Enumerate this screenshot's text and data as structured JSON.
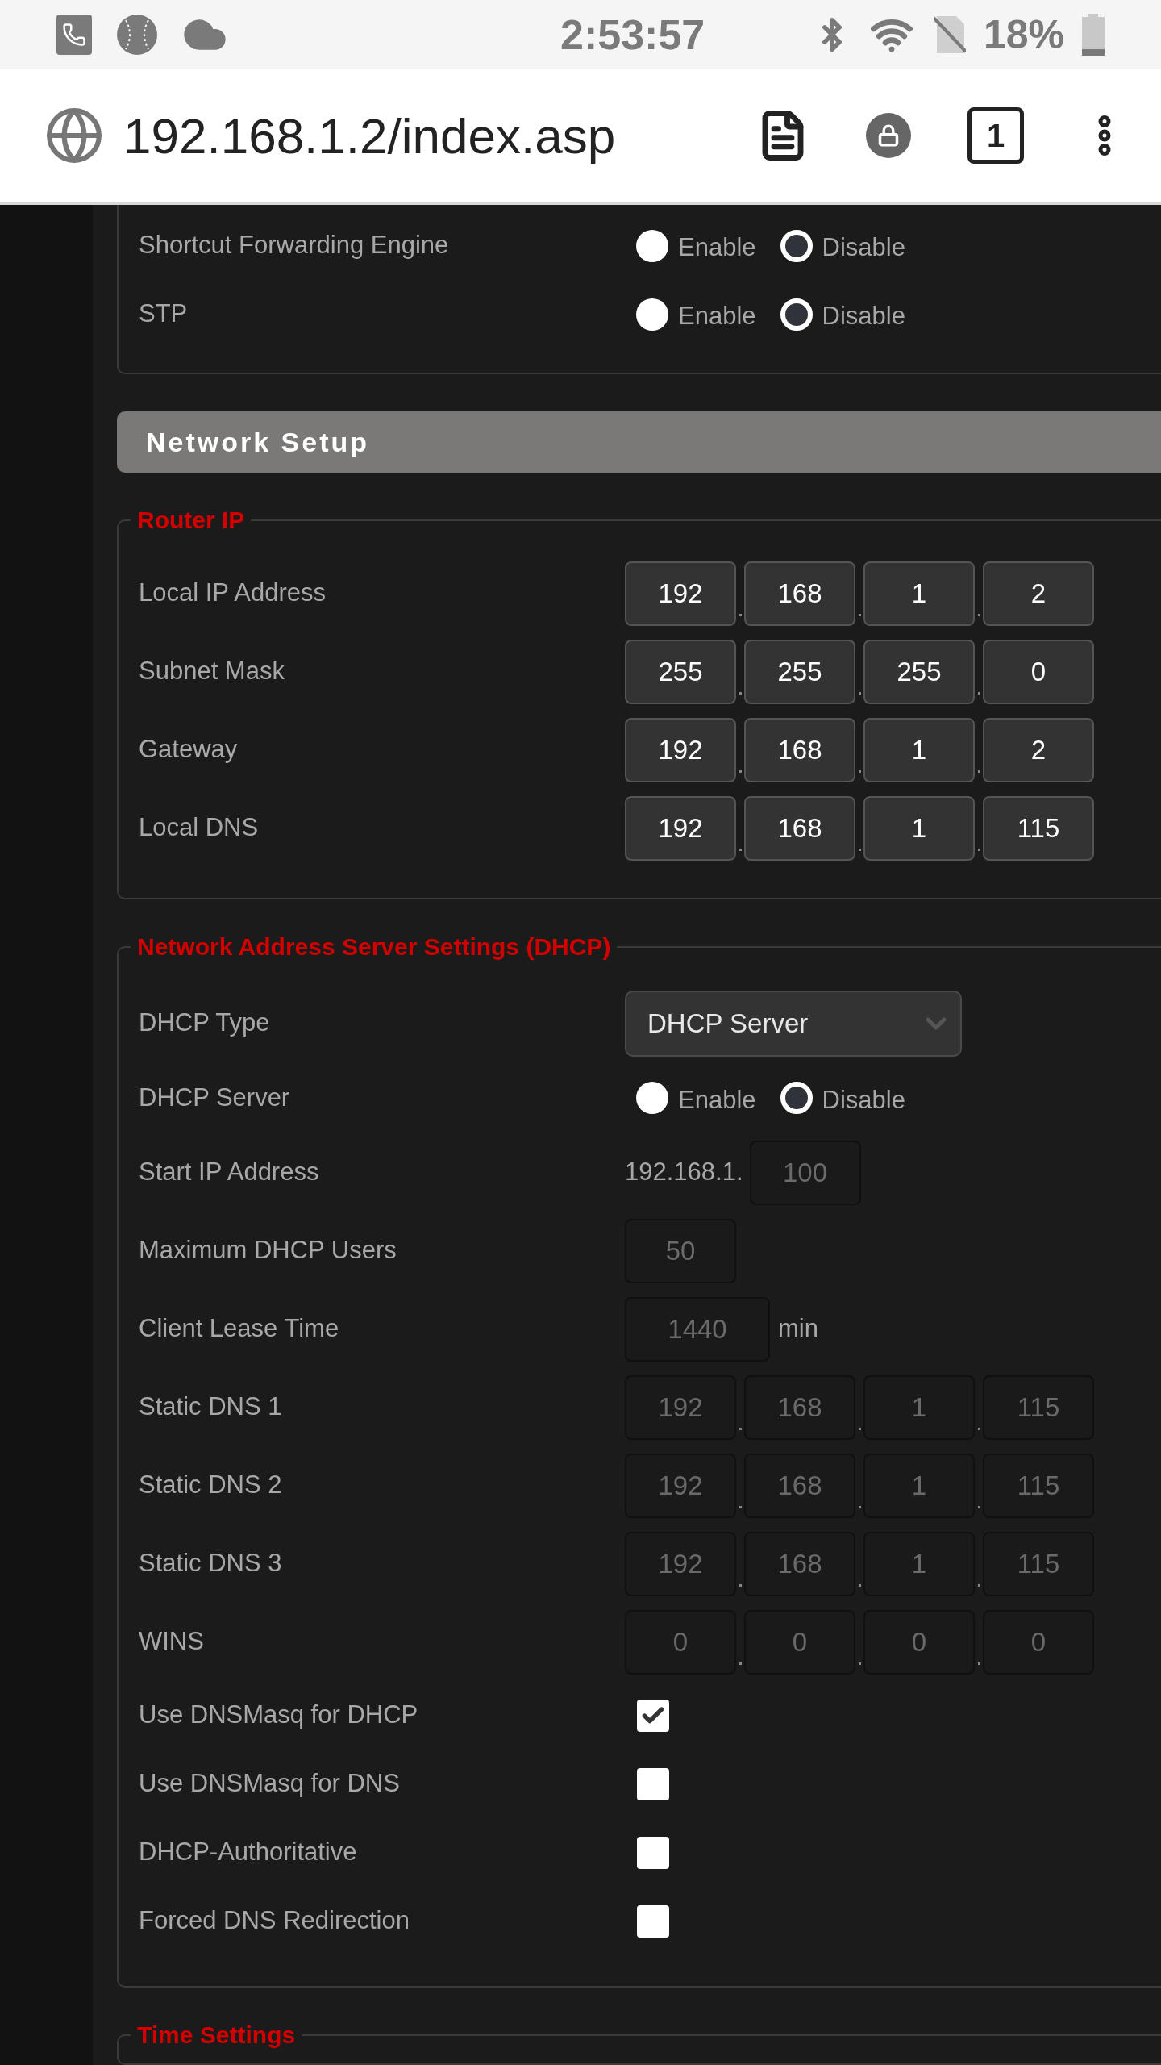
{
  "status_bar": {
    "time": "2:53:57",
    "battery": "18%"
  },
  "address_bar": {
    "url": "192.168.1.2/index.asp",
    "tab_count": "1"
  },
  "top_rows": [
    {
      "label": "Shortcut Forwarding Engine",
      "options": [
        {
          "label": "Enable",
          "selected": false
        },
        {
          "label": "Disable",
          "selected": true
        }
      ]
    },
    {
      "label": "STP",
      "options": [
        {
          "label": "Enable",
          "selected": false
        },
        {
          "label": "Disable",
          "selected": true
        }
      ]
    }
  ],
  "section_header": "Network Setup",
  "fieldsets": [
    {
      "legend": "Router IP",
      "rows": [
        {
          "kind": "ip",
          "label": "Local IP Address",
          "octets": [
            "192",
            "168",
            "1",
            "2"
          ],
          "disabled": false
        },
        {
          "kind": "ip",
          "label": "Subnet Mask",
          "octets": [
            "255",
            "255",
            "255",
            "0"
          ],
          "disabled": false
        },
        {
          "kind": "ip",
          "label": "Gateway",
          "octets": [
            "192",
            "168",
            "1",
            "2"
          ],
          "disabled": false
        },
        {
          "kind": "ip",
          "label": "Local DNS",
          "octets": [
            "192",
            "168",
            "1",
            "115"
          ],
          "disabled": false
        }
      ]
    },
    {
      "legend": "Network Address Server Settings (DHCP)",
      "rows": [
        {
          "kind": "select",
          "label": "DHCP Type",
          "value": "DHCP Server"
        },
        {
          "kind": "radio",
          "label": "DHCP Server",
          "options": [
            {
              "label": "Enable",
              "selected": false
            },
            {
              "label": "Disable",
              "selected": true
            }
          ]
        },
        {
          "kind": "input",
          "label": "Start IP Address",
          "prefix": "192.168.1.",
          "value": "100",
          "disabled": true
        },
        {
          "kind": "input",
          "label": "Maximum DHCP Users",
          "value": "50",
          "disabled": true
        },
        {
          "kind": "input",
          "label": "Client Lease Time",
          "value": "1440",
          "suffix": "min",
          "disabled": true
        },
        {
          "kind": "ip",
          "label": "Static DNS 1",
          "octets": [
            "192",
            "168",
            "1",
            "115"
          ],
          "disabled": true
        },
        {
          "kind": "ip",
          "label": "Static DNS 2",
          "octets": [
            "192",
            "168",
            "1",
            "115"
          ],
          "disabled": true
        },
        {
          "kind": "ip",
          "label": "Static DNS 3",
          "octets": [
            "192",
            "168",
            "1",
            "115"
          ],
          "disabled": true
        },
        {
          "kind": "ip",
          "label": "WINS",
          "octets": [
            "0",
            "0",
            "0",
            "0"
          ],
          "disabled": true
        },
        {
          "kind": "checkbox",
          "label": "Use DNSMasq for DHCP",
          "checked": true
        },
        {
          "kind": "checkbox",
          "label": "Use DNSMasq for DNS",
          "checked": false
        },
        {
          "kind": "checkbox",
          "label": "DHCP-Authoritative",
          "checked": false
        },
        {
          "kind": "checkbox",
          "label": "Forced DNS Redirection",
          "checked": false
        }
      ]
    },
    {
      "legend": "Time Settings"
    }
  ]
}
